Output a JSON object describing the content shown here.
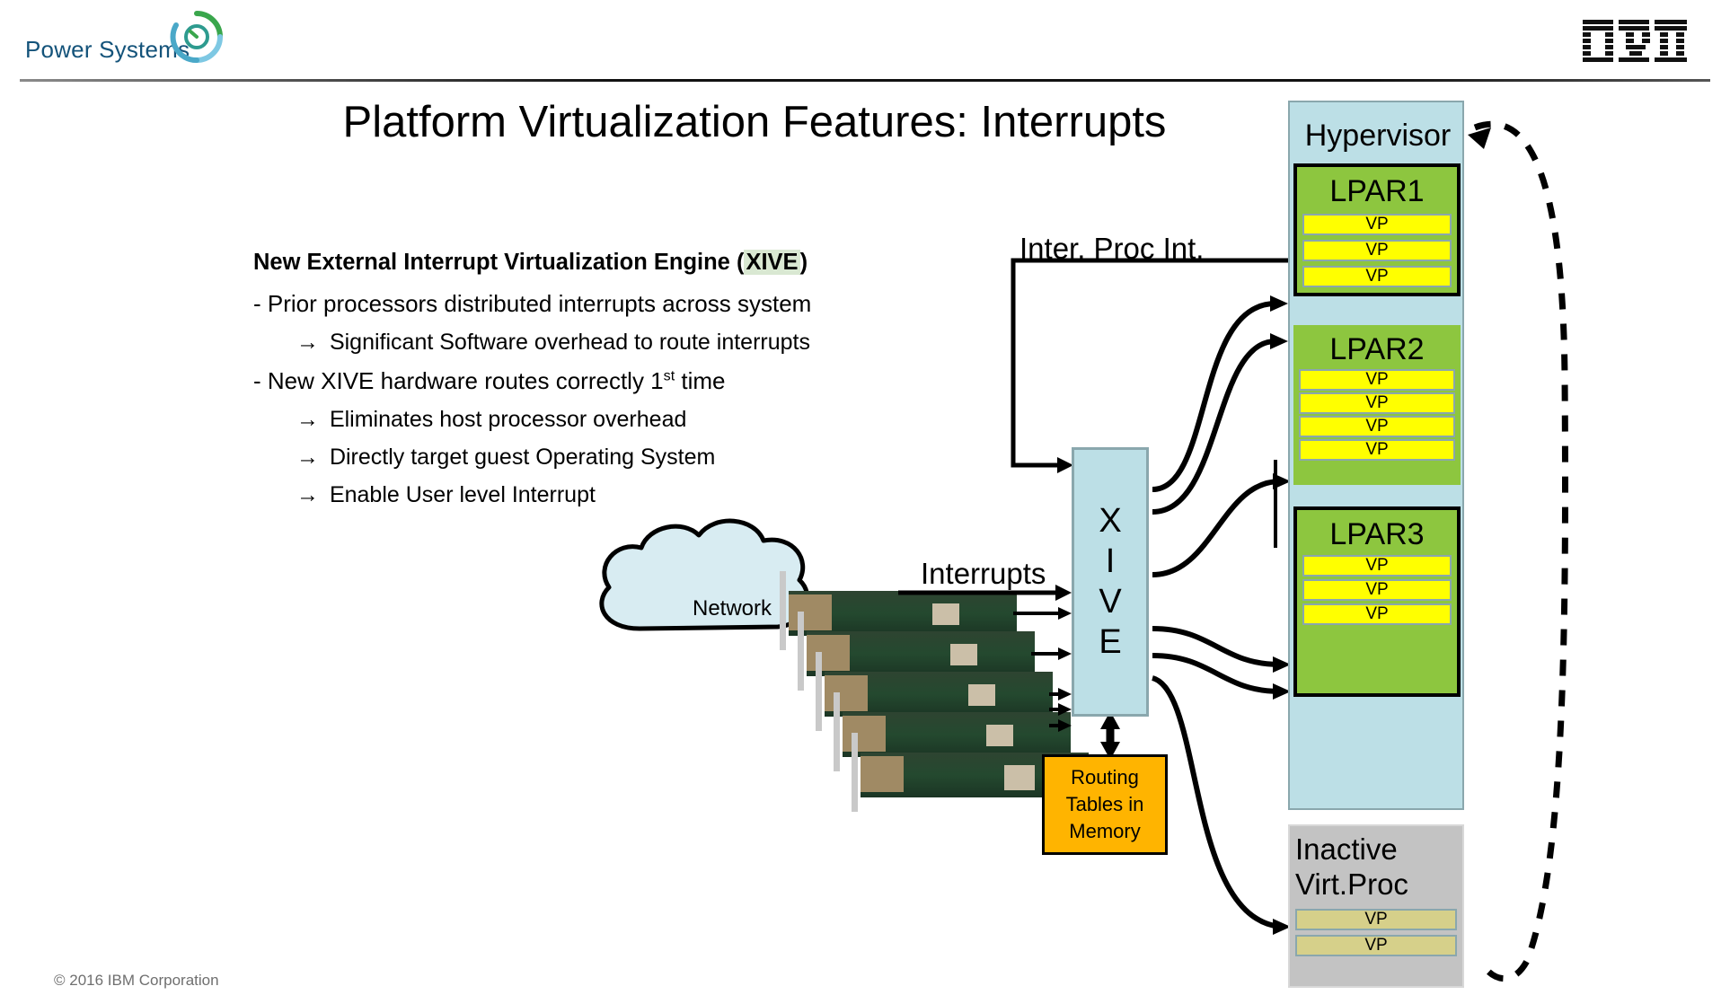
{
  "header": {
    "brand": "Power Systems",
    "brand_mark": "power-systems-swirl",
    "vendor_logo": "ibm-logo"
  },
  "title": "Platform Virtualization Features: Interrupts",
  "bullets": {
    "heading_plain": "New External Interrupt Virtualization Engine (",
    "heading_highlight": "XIVE",
    "heading_tail": ")",
    "items": [
      {
        "level": 1,
        "marker": "-",
        "text": "Prior  processors distributed interrupts across system"
      },
      {
        "level": 2,
        "marker": "→",
        "text": "Significant Software overhead to route interrupts"
      },
      {
        "level": 1,
        "marker": "-",
        "text_pre": "New XIVE  hardware routes correctly 1",
        "sup": "st",
        "text_post": " time"
      },
      {
        "level": 2,
        "marker": "→",
        "text": "Eliminates host processor overhead"
      },
      {
        "level": 2,
        "marker": "→",
        "text": "Directly target guest Operating System"
      },
      {
        "level": 2,
        "marker": "→",
        "text": "Enable User level Interrupt"
      }
    ]
  },
  "diagram": {
    "xive_letters": [
      "X",
      "I",
      "V",
      "E"
    ],
    "routing_box": {
      "line1": "Routing",
      "line2": "Tables in",
      "line3": "Memory"
    },
    "labels": {
      "inter_proc_int": "Inter. Proc Int.",
      "interrupts": "Interrupts",
      "network": "Network"
    },
    "hypervisor": {
      "label": "Hypervisor"
    },
    "lpars": [
      {
        "label": "LPAR1",
        "vps": [
          "VP",
          "VP",
          "VP"
        ]
      },
      {
        "label": "LPAR2",
        "vps": [
          "VP",
          "VP",
          "VP",
          "VP"
        ]
      },
      {
        "label": "LPAR3",
        "vps": [
          "VP",
          "VP",
          "VP"
        ]
      }
    ],
    "inactive": {
      "line1": "Inactive",
      "line2": "Virt.Proc",
      "vps": [
        "VP",
        "VP"
      ]
    },
    "adapters": {
      "count": 5,
      "name": "pcie-network-adapter"
    },
    "colors": {
      "hypervisor_blue": "#bcdfe6",
      "lpar_green": "#8dc63f",
      "vp_yellow": "#ffff00",
      "vp_inactive": "#d6d08a",
      "routing_orange": "#ffb400",
      "inactive_gray": "#c3c3c3",
      "brand_blue": "#14537a",
      "highlight_green": "#d9e8d2"
    }
  },
  "footer": "© 2016  IBM  Corporation"
}
